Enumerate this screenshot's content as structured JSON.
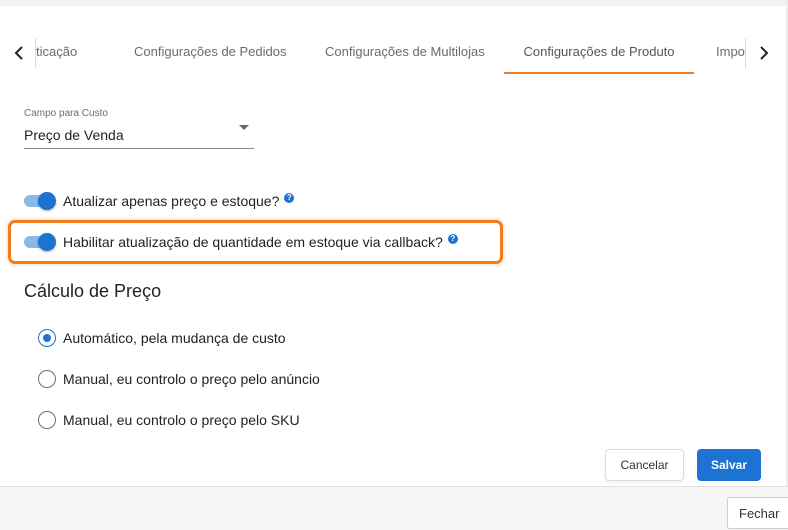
{
  "tabs": {
    "items": [
      {
        "label": "ticação"
      },
      {
        "label": "Configurações de Pedidos"
      },
      {
        "label": "Configurações de Multilojas"
      },
      {
        "label": "Configurações de Produto"
      },
      {
        "label": "Impo"
      }
    ],
    "active_index": 3,
    "accent_color": "#f07c28"
  },
  "cost_field": {
    "label": "Campo para Custo",
    "value": "Preço de Venda"
  },
  "toggles": [
    {
      "label": "Atualizar apenas preço e estoque?",
      "enabled": true
    },
    {
      "label": "Habilitar atualização de quantidade em estoque via callback?",
      "enabled": true
    }
  ],
  "help_icon_glyph": "?",
  "price_calc": {
    "title": "Cálculo de Preço",
    "options": [
      {
        "label": "Automático, pela mudança de custo",
        "checked": true
      },
      {
        "label": "Manual, eu controlo o preço pelo anúncio",
        "checked": false
      },
      {
        "label": "Manual, eu controlo o preço pelo SKU",
        "checked": false
      }
    ]
  },
  "actions": {
    "cancel_label": "Cancelar",
    "save_label": "Salvar"
  },
  "footer": {
    "close_label": "Fechar"
  },
  "colors": {
    "primary": "#1c73d1",
    "highlight": "#f07c1e"
  }
}
